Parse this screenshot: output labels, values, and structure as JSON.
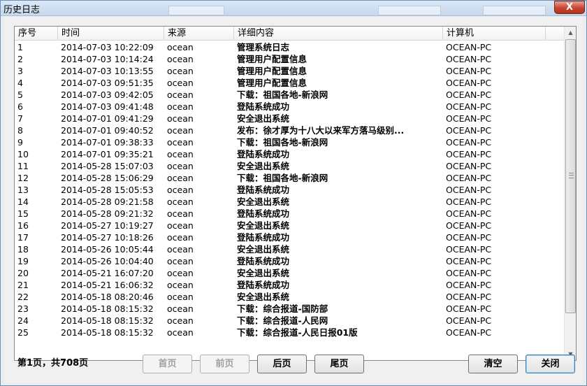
{
  "window": {
    "title": "历史日志",
    "close_label": "X"
  },
  "table": {
    "columns": [
      "序号",
      "时间",
      "来源",
      "详细内容",
      "计算机"
    ],
    "rows": [
      [
        "1",
        "2014-07-03 10:22:09",
        "ocean",
        "管理系统日志",
        "OCEAN-PC"
      ],
      [
        "2",
        "2014-07-03 10:14:24",
        "ocean",
        "管理用户配置信息",
        "OCEAN-PC"
      ],
      [
        "3",
        "2014-07-03 10:13:55",
        "ocean",
        "管理用户配置信息",
        "OCEAN-PC"
      ],
      [
        "4",
        "2014-07-03 09:51:35",
        "ocean",
        "管理用户配置信息",
        "OCEAN-PC"
      ],
      [
        "5",
        "2014-07-03 09:42:05",
        "ocean",
        "下载：祖国各地-新浪网",
        "OCEAN-PC"
      ],
      [
        "6",
        "2014-07-03 09:41:48",
        "ocean",
        "登陆系统成功",
        "OCEAN-PC"
      ],
      [
        "7",
        "2014-07-01 09:41:29",
        "ocean",
        "安全退出系统",
        "OCEAN-PC"
      ],
      [
        "8",
        "2014-07-01 09:40:52",
        "ocean",
        "发布：徐才厚为十八大以来军方落马级别...",
        "OCEAN-PC"
      ],
      [
        "9",
        "2014-07-01 09:38:33",
        "ocean",
        "下载：祖国各地-新浪网",
        "OCEAN-PC"
      ],
      [
        "10",
        "2014-07-01 09:35:21",
        "ocean",
        "登陆系统成功",
        "OCEAN-PC"
      ],
      [
        "11",
        "2014-05-28 15:07:03",
        "ocean",
        "安全退出系统",
        "OCEAN-PC"
      ],
      [
        "12",
        "2014-05-28 15:06:29",
        "ocean",
        "下载：祖国各地-新浪网",
        "OCEAN-PC"
      ],
      [
        "13",
        "2014-05-28 15:05:53",
        "ocean",
        "登陆系统成功",
        "OCEAN-PC"
      ],
      [
        "14",
        "2014-05-28 09:21:58",
        "ocean",
        "安全退出系统",
        "OCEAN-PC"
      ],
      [
        "15",
        "2014-05-28 09:21:32",
        "ocean",
        "登陆系统成功",
        "OCEAN-PC"
      ],
      [
        "16",
        "2014-05-27 10:19:27",
        "ocean",
        "安全退出系统",
        "OCEAN-PC"
      ],
      [
        "17",
        "2014-05-27 10:18:26",
        "ocean",
        "登陆系统成功",
        "OCEAN-PC"
      ],
      [
        "18",
        "2014-05-26 10:05:44",
        "ocean",
        "安全退出系统",
        "OCEAN-PC"
      ],
      [
        "19",
        "2014-05-26 10:04:40",
        "ocean",
        "登陆系统成功",
        "OCEAN-PC"
      ],
      [
        "20",
        "2014-05-21 16:07:20",
        "ocean",
        "安全退出系统",
        "OCEAN-PC"
      ],
      [
        "21",
        "2014-05-21 16:06:32",
        "ocean",
        "登陆系统成功",
        "OCEAN-PC"
      ],
      [
        "22",
        "2014-05-18 08:20:46",
        "ocean",
        "安全退出系统",
        "OCEAN-PC"
      ],
      [
        "23",
        "2014-05-18 08:15:32",
        "ocean",
        "下载：综合报道-国防部",
        "OCEAN-PC"
      ],
      [
        "24",
        "2014-05-18 08:15:32",
        "ocean",
        "下载：综合报道-人民网",
        "OCEAN-PC"
      ],
      [
        "25",
        "2014-05-18 08:15:32",
        "ocean",
        "下载：综合报道-人民日报01版",
        "OCEAN-PC"
      ]
    ]
  },
  "footer": {
    "page_info": "第1页，共708页",
    "first_label": "首页",
    "prev_label": "前页",
    "next_label": "后页",
    "last_label": "尾页",
    "clear_label": "清空",
    "close_label": "关闭"
  },
  "icons": {
    "scroll_up": "triangle-up",
    "scroll_down": "triangle-down"
  }
}
